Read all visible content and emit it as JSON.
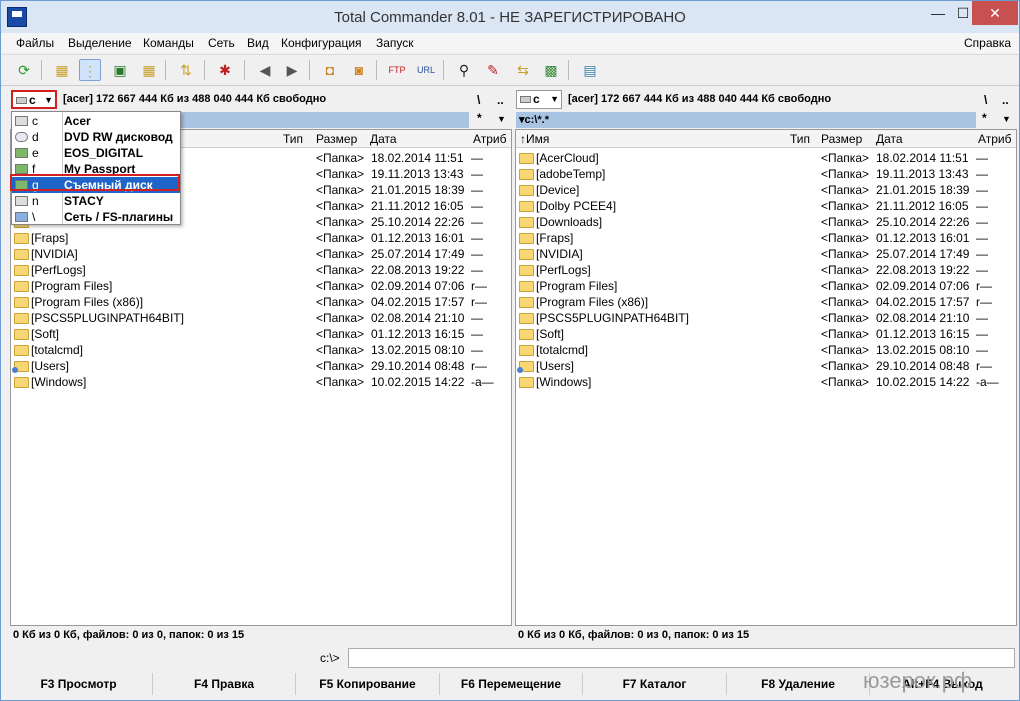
{
  "window": {
    "title": "Total Commander 8.01 - НЕ ЗАРЕГИСТРИРОВАНО",
    "min": "—",
    "max": "☐",
    "close": "✕"
  },
  "menu": [
    "Файлы",
    "Выделение",
    "Команды",
    "Сеть",
    "Вид",
    "Конфигурация",
    "Запуск"
  ],
  "menu_right": "Справка",
  "left": {
    "drive": "c",
    "free": "[acer]  172 667 444 Кб из 488 040 444 Кб свободно",
    "path": "",
    "root_btn": "\\",
    "up_btn": "..",
    "star_btn": "*",
    "sort_btn": "▼",
    "columns": {
      "name": "",
      "type": "Тип",
      "size": "Размер",
      "date": "Дата",
      "attr": "Атриб"
    },
    "rows": [
      {
        "name": "[Fraps]",
        "size": "<Папка>",
        "date": "01.12.2013 16:01",
        "attr": "—"
      },
      {
        "name": "[NVIDIA]",
        "size": "<Папка>",
        "date": "25.07.2014 17:49",
        "attr": "—"
      },
      {
        "name": "[PerfLogs]",
        "size": "<Папка>",
        "date": "22.08.2013 19:22",
        "attr": "—"
      },
      {
        "name": "[Program Files]",
        "size": "<Папка>",
        "date": "02.09.2014 07:06",
        "attr": "r—"
      },
      {
        "name": "[Program Files (x86)]",
        "size": "<Папка>",
        "date": "04.02.2015 17:57",
        "attr": "r—"
      },
      {
        "name": "[PSCS5PLUGINPATH64BIT]",
        "size": "<Папка>",
        "date": "02.08.2014 21:10",
        "attr": "—"
      },
      {
        "name": "[Soft]",
        "size": "<Папка>",
        "date": "01.12.2013 16:15",
        "attr": "—"
      },
      {
        "name": "[totalcmd]",
        "size": "<Папка>",
        "date": "13.02.2015 08:10",
        "attr": "—"
      },
      {
        "name": "[Users]",
        "size": "<Папка>",
        "date": "29.10.2014 08:48",
        "attr": "r—"
      },
      {
        "name": "[Windows]",
        "size": "<Папка>",
        "date": "10.02.2015 14:22",
        "attr": "-a—"
      }
    ],
    "hidden_rows": [
      {
        "size": "<Папка>",
        "date": "18.02.2014 11:51",
        "attr": "—"
      },
      {
        "size": "<Папка>",
        "date": "19.11.2013 13:43",
        "attr": "—"
      },
      {
        "size": "<Папка>",
        "date": "21.01.2015 18:39",
        "attr": "—"
      },
      {
        "size": "<Папка>",
        "date": "21.11.2012 16:05",
        "attr": "—"
      },
      {
        "size": "<Папка>",
        "date": "25.10.2014 22:26",
        "attr": "—"
      }
    ],
    "status": "0 Кб из 0 Кб, файлов: 0 из 0, папок: 0 из 15"
  },
  "right": {
    "drive": "c",
    "free": "[acer]  172 667 444 Кб из 488 040 444 Кб свободно",
    "path": "▾c:\\*.*",
    "root_btn": "\\",
    "up_btn": "..",
    "star_btn": "*",
    "sort_btn": "▼",
    "columns": {
      "name": "↑Имя",
      "type": "Тип",
      "size": "Размер",
      "date": "Дата",
      "attr": "Атриб"
    },
    "rows": [
      {
        "name": "[AcerCloud]",
        "size": "<Папка>",
        "date": "18.02.2014 11:51",
        "attr": "—"
      },
      {
        "name": "[adobeTemp]",
        "size": "<Папка>",
        "date": "19.11.2013 13:43",
        "attr": "—"
      },
      {
        "name": "[Device]",
        "size": "<Папка>",
        "date": "21.01.2015 18:39",
        "attr": "—"
      },
      {
        "name": "[Dolby PCEE4]",
        "size": "<Папка>",
        "date": "21.11.2012 16:05",
        "attr": "—"
      },
      {
        "name": "[Downloads]",
        "size": "<Папка>",
        "date": "25.10.2014 22:26",
        "attr": "—"
      },
      {
        "name": "[Fraps]",
        "size": "<Папка>",
        "date": "01.12.2013 16:01",
        "attr": "—"
      },
      {
        "name": "[NVIDIA]",
        "size": "<Папка>",
        "date": "25.07.2014 17:49",
        "attr": "—"
      },
      {
        "name": "[PerfLogs]",
        "size": "<Папка>",
        "date": "22.08.2013 19:22",
        "attr": "—"
      },
      {
        "name": "[Program Files]",
        "size": "<Папка>",
        "date": "02.09.2014 07:06",
        "attr": "r—"
      },
      {
        "name": "[Program Files (x86)]",
        "size": "<Папка>",
        "date": "04.02.2015 17:57",
        "attr": "r—"
      },
      {
        "name": "[PSCS5PLUGINPATH64BIT]",
        "size": "<Папка>",
        "date": "02.08.2014 21:10",
        "attr": "—"
      },
      {
        "name": "[Soft]",
        "size": "<Папка>",
        "date": "01.12.2013 16:15",
        "attr": "—"
      },
      {
        "name": "[totalcmd]",
        "size": "<Папка>",
        "date": "13.02.2015 08:10",
        "attr": "—"
      },
      {
        "name": "[Users]",
        "size": "<Папка>",
        "date": "29.10.2014 08:48",
        "attr": "r—"
      },
      {
        "name": "[Windows]",
        "size": "<Папка>",
        "date": "10.02.2015 14:22",
        "attr": "-a—"
      }
    ],
    "status": "0 Кб из 0 Кб, файлов: 0 из 0, папок: 0 из 15"
  },
  "drive_menu": [
    {
      "letter": "c",
      "label": "Acer",
      "icon": "hdd"
    },
    {
      "letter": "d",
      "label": "DVD RW дисковод",
      "icon": "dvd"
    },
    {
      "letter": "e",
      "label": "EOS_DIGITAL",
      "icon": "usb"
    },
    {
      "letter": "f",
      "label": "My Passport",
      "icon": "usb"
    },
    {
      "letter": "g",
      "label": "Съемный диск",
      "icon": "usb",
      "selected": true
    },
    {
      "letter": "n",
      "label": "STACY",
      "icon": "hdd"
    },
    {
      "letter": "\\",
      "label": "Сеть / FS-плагины",
      "icon": "net"
    }
  ],
  "cmd": {
    "label": "c:\\>",
    "value": ""
  },
  "fkeys": [
    "F3 Просмотр",
    "F4 Правка",
    "F5 Копирование",
    "F6 Перемещение",
    "F7 Каталог",
    "F8 Удаление",
    "Alt+F4 Выход"
  ],
  "watermark": "юзерок.рф",
  "colors": {
    "accent": "#1f64c8",
    "highlight": "#d02020",
    "path_bar": "#a9c3e3",
    "folder": "#f7d774"
  }
}
